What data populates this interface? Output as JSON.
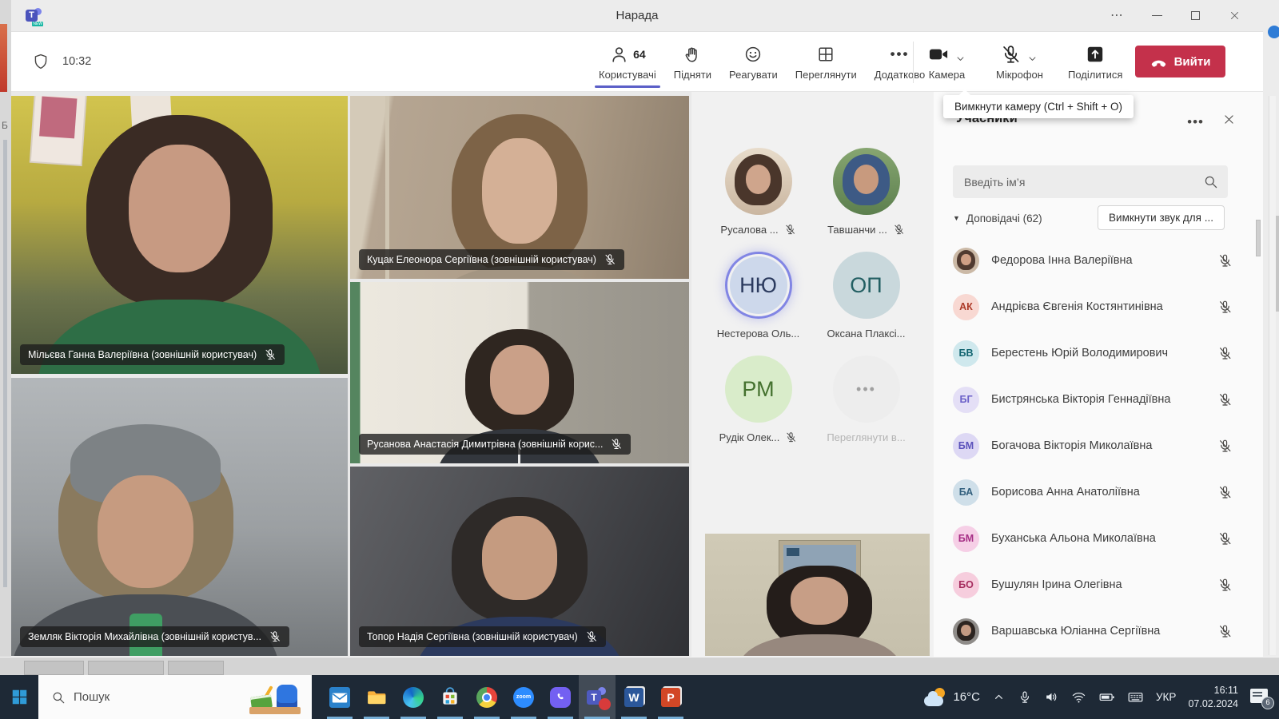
{
  "window": {
    "title": "Нарада"
  },
  "toolbar": {
    "timer": "10:32",
    "participants_tab": {
      "label": "Користувачі",
      "count": "64"
    },
    "raise_tab": "Підняти",
    "react_tab": "Реагувати",
    "view_tab": "Переглянути",
    "more_tab": "Додатково",
    "camera_label": "Камера",
    "mic_label": "Мікрофон",
    "share_label": "Поділитися",
    "leave_label": "Вийти"
  },
  "tooltip": "Вимкнути камеру (Ctrl + Shift + O)",
  "video_tiles": [
    {
      "name": "Мільєва Ганна Валеріївна (зовнішній користувач)",
      "muted": true
    },
    {
      "name": "Куцак Елеонора Сергіївна (зовнішній користувач)",
      "muted": true
    },
    {
      "name": "Земляк Вікторія Михайлівна (зовнішній користув...",
      "muted": true
    },
    {
      "name": "Русанова Анастасія Димитрівна (зовнішній корис...",
      "muted": true
    },
    {
      "name": "Топор Надія Сергіївна (зовнішній користувач)",
      "muted": true
    }
  ],
  "avatar_tiles": [
    {
      "label": "Русалова ...",
      "type": "photo",
      "muted": true
    },
    {
      "label": "Тавшанчи ...",
      "type": "photo",
      "muted": true
    },
    {
      "label": "Нестерова Оль...",
      "type": "initials",
      "initials": "НЮ",
      "speaking": true
    },
    {
      "label": "Оксана Плаксі...",
      "type": "initials",
      "initials": "ОП"
    },
    {
      "label": "Рудік Олек...",
      "type": "initials",
      "initials": "РМ",
      "muted": true
    },
    {
      "label": "Переглянути в...",
      "type": "overflow",
      "glyph": "•••"
    }
  ],
  "participants_panel": {
    "title": "Учасники",
    "search_placeholder": "Введіть ім’я",
    "section_label": "Доповідачі (62)",
    "mute_all_button": "Вимкнути звук для ...",
    "rows": [
      {
        "name": "Федорова Інна Валеріївна",
        "photo": true,
        "bg": "#cbb9a6",
        "hair": "#503a30",
        "skin": "#cf9f85",
        "muted": true
      },
      {
        "name": "Андрієва Євгенія Костянтинівна",
        "initials": "АК",
        "bg": "#f8d8d2",
        "fg": "#ad3a28",
        "muted": true
      },
      {
        "name": "Берестень Юрій Володимирович",
        "initials": "БВ",
        "bg": "#cfe8ed",
        "fg": "#116470",
        "muted": true
      },
      {
        "name": "Бистрянська Вікторія Геннадіївна",
        "initials": "БГ",
        "bg": "#e4dff6",
        "fg": "#6a5fc8",
        "muted": true
      },
      {
        "name": "Богачова Вікторія Миколаївна",
        "initials": "БМ",
        "bg": "#ddd8f4",
        "fg": "#5b52bb",
        "muted": true
      },
      {
        "name": "Борисова Анна Анатоліївна",
        "initials": "БА",
        "bg": "#cfdfe9",
        "fg": "#33607e",
        "muted": true
      },
      {
        "name": "Буханська Альона Миколаївна",
        "initials": "БМ",
        "bg": "#f6cfe6",
        "fg": "#a62e85",
        "muted": true
      },
      {
        "name": "Бушулян Ірина Олегівна",
        "initials": "БО",
        "bg": "#f6cddd",
        "fg": "#a52c5e",
        "muted": true
      },
      {
        "name": "Варшавська Юліанна Сергіївна",
        "photo": true,
        "bg": "#8f8c89",
        "hair": "#2c2420",
        "skin": "#c49a82",
        "muted": true
      }
    ]
  },
  "taskbar": {
    "search_placeholder": "Пошук",
    "weather_temp": "16°C",
    "language": "УКР",
    "time": "16:11",
    "date": "07.02.2024",
    "notification_count": "6",
    "zoom_label": "zoom",
    "word_label": "W",
    "powerpoint_label": "P",
    "teams_label": "T"
  },
  "colors": {
    "accent": "#5b5fc7",
    "leave_red": "#c4314b",
    "speaking_ring": "#8185e4",
    "taskbar_bg": "#1e2936"
  }
}
